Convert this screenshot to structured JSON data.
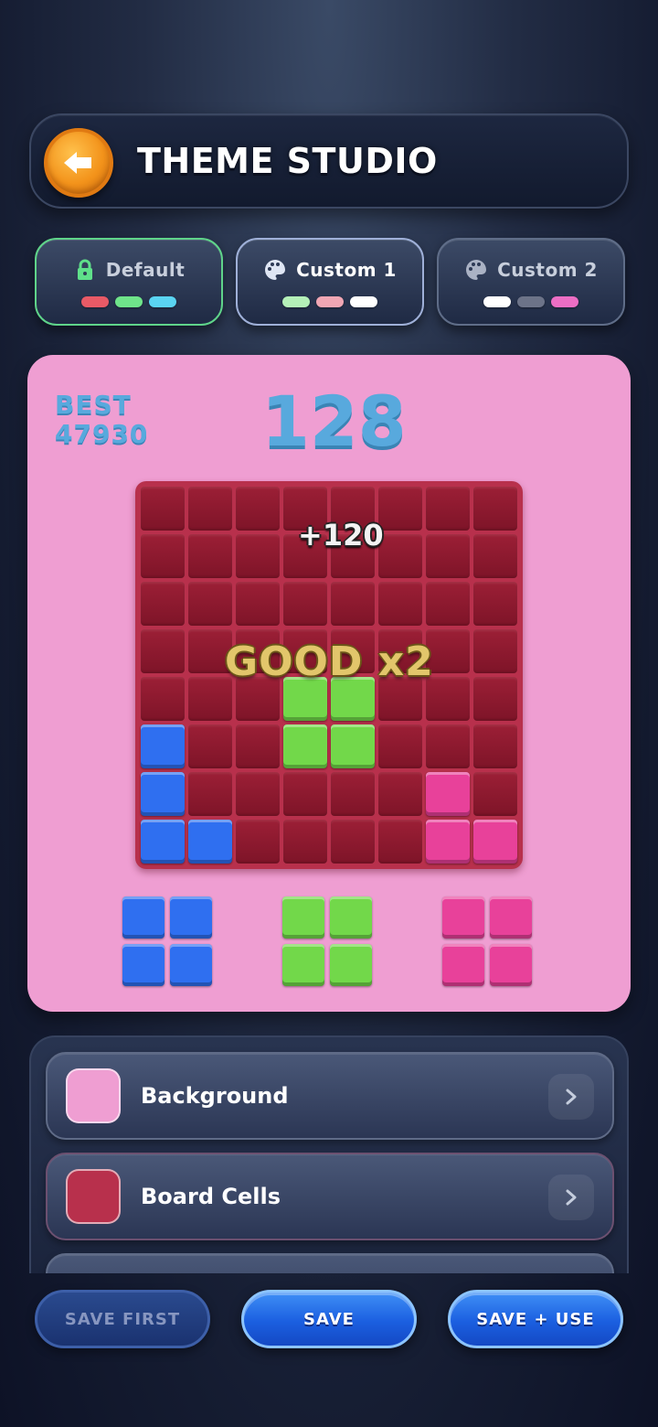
{
  "header": {
    "title": "THEME STUDIO",
    "back_icon": "arrow-left-icon"
  },
  "themes": [
    {
      "label": "Default",
      "icon": "lock-icon",
      "icon_color": "#5fe08a",
      "swatches": [
        "#e85a66",
        "#6fe48a",
        "#5ad4f2"
      ],
      "state": "locked"
    },
    {
      "label": "Custom 1",
      "icon": "palette-icon",
      "icon_color": "#dfe6f4",
      "swatches": [
        "#b4f0b8",
        "#f0a6b4",
        "#ffffff"
      ],
      "state": "selected"
    },
    {
      "label": "Custom 2",
      "icon": "palette-icon",
      "icon_color": "#aab2c4",
      "swatches": [
        "#ffffff",
        "#6c7388",
        "#ec6ec4"
      ],
      "state": "idle"
    }
  ],
  "preview": {
    "background": "#ef9ed2",
    "best_label": "BEST",
    "best_value": "47930",
    "score": "128",
    "floating_score": "+120",
    "combo_text": "GOOD x2",
    "board_color": "#b8304c",
    "grid_size": 8,
    "blocks": [
      {
        "row": 4,
        "col": 3,
        "color": "green"
      },
      {
        "row": 4,
        "col": 4,
        "color": "green"
      },
      {
        "row": 5,
        "col": 3,
        "color": "green"
      },
      {
        "row": 5,
        "col": 4,
        "color": "green"
      },
      {
        "row": 5,
        "col": 0,
        "color": "blue"
      },
      {
        "row": 6,
        "col": 0,
        "color": "blue"
      },
      {
        "row": 7,
        "col": 0,
        "color": "blue"
      },
      {
        "row": 7,
        "col": 1,
        "color": "blue"
      },
      {
        "row": 6,
        "col": 6,
        "color": "pink"
      },
      {
        "row": 7,
        "col": 6,
        "color": "pink"
      },
      {
        "row": 7,
        "col": 7,
        "color": "pink"
      }
    ],
    "pieces": [
      "blue",
      "green",
      "pink"
    ],
    "block_colors": {
      "blue": "#2f6ff0",
      "green": "#72d84a",
      "pink": "#e8419a"
    }
  },
  "settings": [
    {
      "label": "Background",
      "color": "#ef9ed2"
    },
    {
      "label": "Board Cells",
      "color": "#b8304c"
    }
  ],
  "actions": {
    "save_first": "SAVE FIRST",
    "save": "SAVE",
    "save_use": "SAVE + USE"
  }
}
